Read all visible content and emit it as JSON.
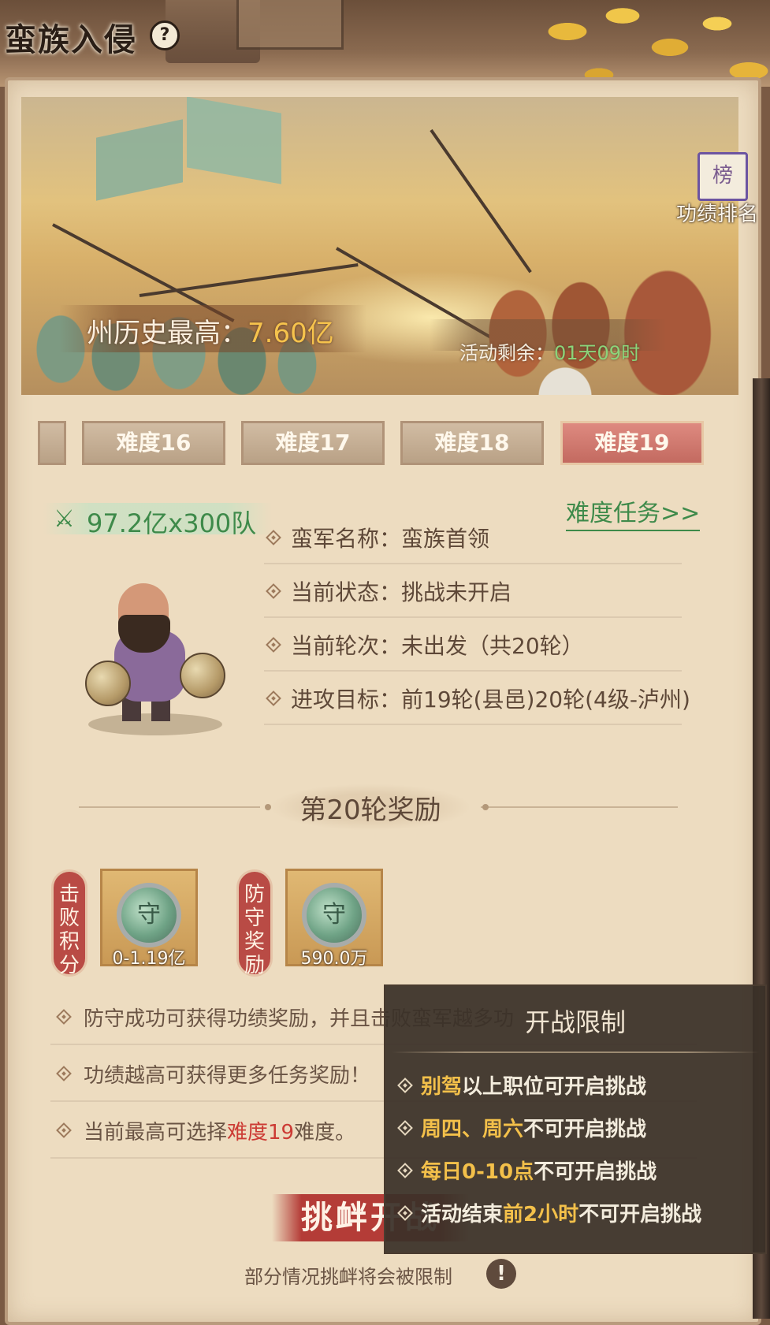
{
  "header": {
    "title": "蛮族入侵",
    "help": "?"
  },
  "banner": {
    "history_label": "州历史最高：",
    "history_value": "7.60亿",
    "remain_label": "活动剩余：",
    "remain_value": "01天09时",
    "rank_icon": "榜",
    "rank_label": "功绩排名"
  },
  "difficulty_tabs": [
    {
      "label": "难度16",
      "active": false
    },
    {
      "label": "难度17",
      "active": false
    },
    {
      "label": "难度18",
      "active": false
    },
    {
      "label": "难度19",
      "active": true
    }
  ],
  "power": {
    "icon": "crossed-weapons-icon",
    "value": "97.2亿",
    "suffix": "x300队"
  },
  "task_link": "难度任务>>",
  "info": [
    "蛮军名称：蛮族首领",
    "当前状态：挑战未开启",
    "当前轮次：未出发（共20轮）",
    "进攻目标：前19轮(县邑)20轮(4级-泸州)"
  ],
  "reward": {
    "title": "第20轮奖励",
    "items": [
      {
        "tag": "击败积分",
        "icon": "守",
        "amount": "0-1.19亿"
      },
      {
        "tag": "防守奖励",
        "icon": "守",
        "amount": "590.0万"
      }
    ]
  },
  "notes": [
    {
      "text": "防守成功可获得功绩奖励，并且击败蛮军越多功"
    },
    {
      "text": "功绩越高可获得更多任务奖励！"
    },
    {
      "prefix": "当前最高可选择",
      "highlight": "难度19",
      "suffix": "难度。"
    }
  ],
  "challenge": {
    "button_label": "挑衅开战",
    "footer_note": "部分情况挑衅将会被限制",
    "warn_icon": "!"
  },
  "popup": {
    "title": "开战限制",
    "rows": [
      {
        "hl": "别驾",
        "rest": "以上职位可开启挑战"
      },
      {
        "hl": "周四、周六",
        "rest": "不可开启挑战"
      },
      {
        "hl": "每日0-10点",
        "rest": "不可开启挑战"
      },
      {
        "pre": "活动结束",
        "hl": "前2小时",
        "rest": "不可开启挑战"
      }
    ]
  },
  "colors": {
    "accent_red": "#c36a60",
    "green": "#3e8a4a",
    "gold": "#f3c04a",
    "paper": "#eddcc0"
  }
}
